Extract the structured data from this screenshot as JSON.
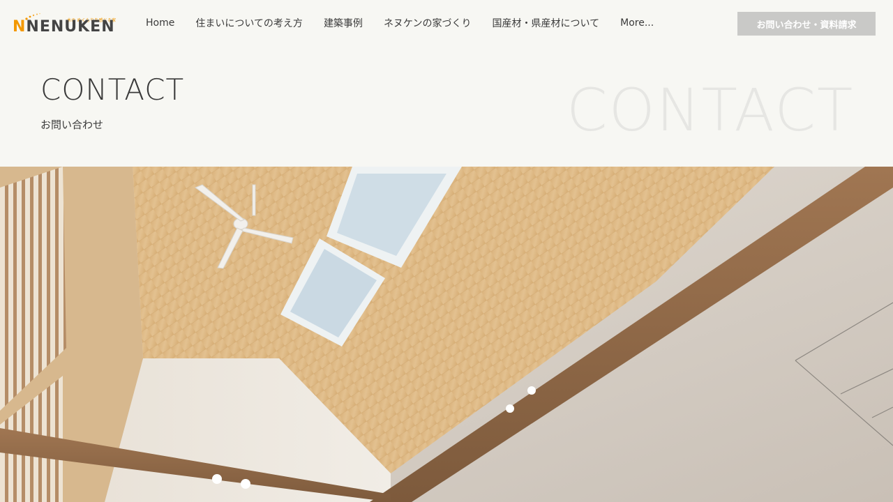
{
  "header": {
    "logo": {
      "tagline": "木の ぬくもりを感じる家",
      "text_first": "N",
      "text_rest": "NENUKEN"
    },
    "nav": [
      {
        "label": "Home"
      },
      {
        "label": "住まいについての考え方"
      },
      {
        "label": "建築事例"
      },
      {
        "label": "ネヌケンの家づくり"
      },
      {
        "label": "国産材・県産材について"
      },
      {
        "label": "More..."
      }
    ],
    "cta_label": "お問い合わせ・資料請求"
  },
  "hero": {
    "title": "CONTACT",
    "subtitle": "お問い合わせ",
    "background_word": "CONTACT"
  },
  "colors": {
    "background": "#f7f7f3",
    "brand_orange": "#f39800",
    "cta_bg": "#c9c9c7",
    "text": "#3a3a3a"
  }
}
